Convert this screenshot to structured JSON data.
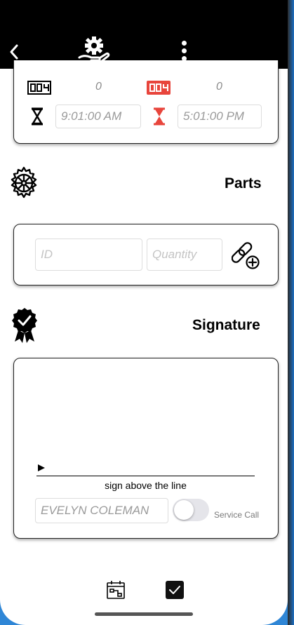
{
  "timer": {
    "start_count": "0",
    "end_count": "0",
    "start_time": "9:01:00 AM",
    "end_time": "5:01:00 PM"
  },
  "parts": {
    "title": "Parts",
    "id_placeholder": "ID",
    "quantity_placeholder": "Quantity"
  },
  "signature": {
    "title": "Signature",
    "line_label": "sign above the line",
    "name_value": "EVELYN COLEMAN",
    "service_call_label": "Service Call",
    "service_call_on": false
  },
  "colors": {
    "header_bg": "#000000",
    "accent_red": "#e8453c",
    "background": "#2f86d6"
  },
  "icons": {
    "header": [
      "back-chevron-icon",
      "gear-hand-logo-icon",
      "more-vertical-icon"
    ],
    "timer": [
      "start-counter-icon",
      "end-counter-icon",
      "start-hourglass-icon",
      "end-hourglass-icon"
    ],
    "parts": [
      "gear-wheel-icon",
      "link-add-icon"
    ],
    "signature": [
      "certificate-check-icon",
      "play-marker-icon"
    ],
    "footer": [
      "calendar-icon",
      "checkbox-checked-icon"
    ]
  }
}
